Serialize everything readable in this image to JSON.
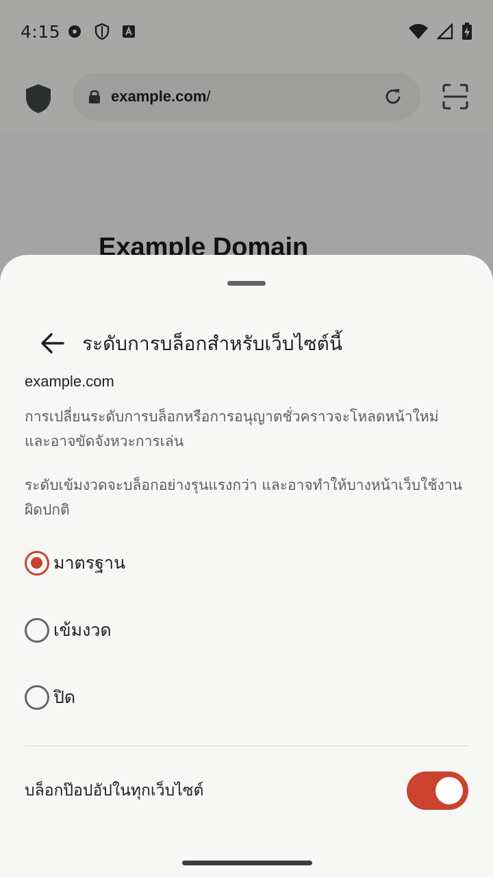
{
  "status_bar": {
    "time": "4:15"
  },
  "toolbar": {
    "url_host": "example.com",
    "url_path": "/"
  },
  "web_page": {
    "heading": "Example Domain"
  },
  "sheet": {
    "title": "ระดับการบล็อกสำหรับเว็บไซต์นี้",
    "site": "example.com",
    "description_1": "การเปลี่ยนระดับการบล็อกหรือการอนุญาตชั่วคราวจะโหลดหน้าใหม่และอาจขัดจังหวะการเล่น",
    "description_2": "ระดับเข้มงวดจะบล็อกอย่างรุนแรงกว่า และอาจทำให้บางหน้าเว็บใช้งานผิดปกติ",
    "options": [
      {
        "label": "มาตรฐาน",
        "selected": true
      },
      {
        "label": "เข้มงวด",
        "selected": false
      },
      {
        "label": "ปิด",
        "selected": false
      }
    ],
    "popup_toggle": {
      "label": "บล็อกป๊อปอัปในทุกเว็บไซต์",
      "on": true
    }
  },
  "colors": {
    "accent": "#c9432e",
    "sheet_background": "#f7f7f5"
  }
}
